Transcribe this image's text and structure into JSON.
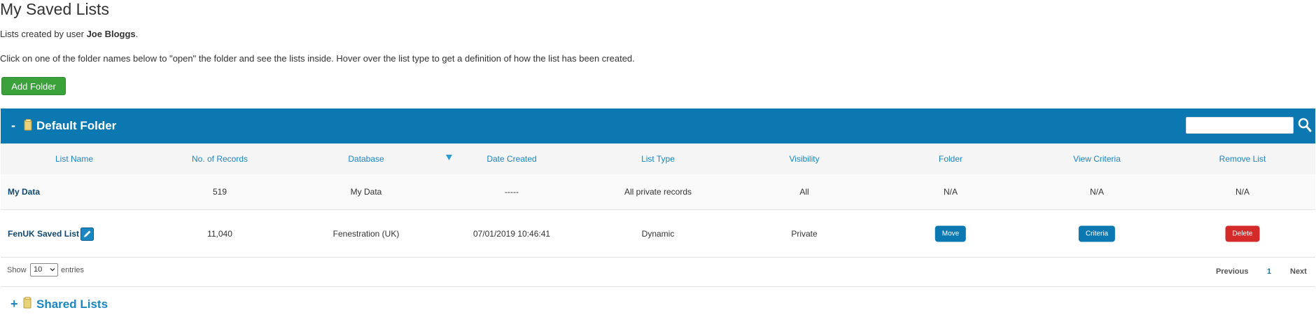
{
  "page": {
    "title": "My Saved Lists",
    "byline_prefix": "Lists created by user ",
    "byline_user": "Joe Bloggs",
    "byline_suffix": ".",
    "instructions": "Click on one of the folder names below to \"open\" the folder and see the lists inside. Hover over the list type to get a definition of how the list has been created.",
    "add_folder_label": "Add Folder"
  },
  "folder": {
    "toggle": "-",
    "title": "Default Folder",
    "search_value": ""
  },
  "table": {
    "columns": [
      "List Name",
      "No. of Records",
      "Database",
      "Date Created",
      "List Type",
      "Visibility",
      "Folder",
      "View Criteria",
      "Remove List"
    ],
    "rows": [
      {
        "list_name": "My Data",
        "records": "519",
        "database": "My Data",
        "date_created": "-----",
        "list_type": "All private records",
        "visibility": "All",
        "folder": "N/A",
        "view_criteria": "N/A",
        "remove": "N/A"
      },
      {
        "list_name": "FenUK Saved List",
        "records": "11,040",
        "database": "Fenestration (UK)",
        "date_created": "07/01/2019 10:46:41",
        "list_type": "Dynamic",
        "visibility": "Private",
        "folder_button": "Move",
        "criteria_button": "Criteria",
        "delete_button": "Delete"
      }
    ]
  },
  "footer": {
    "show_label": "Show",
    "page_length": "10",
    "entries_label": "entries",
    "previous": "Previous",
    "current_page": "1",
    "next": "Next"
  },
  "shared": {
    "toggle": "+",
    "title": "Shared Lists"
  },
  "colors": {
    "header_blue": "#0b78b1",
    "link_blue": "#1b86c0",
    "add_green": "#3ba13b",
    "delete_red": "#d42a2a"
  },
  "icons": [
    "folder-icon",
    "search-icon",
    "sort-desc-icon",
    "edit-icon",
    "chevron-down-icon"
  ]
}
